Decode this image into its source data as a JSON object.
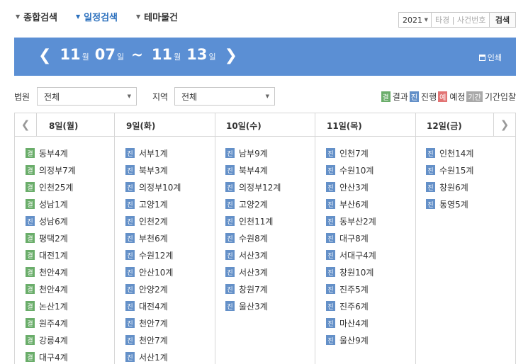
{
  "tabs": [
    {
      "label": "종합검색",
      "active": false
    },
    {
      "label": "일정검색",
      "active": true
    },
    {
      "label": "테마물건",
      "active": false
    }
  ],
  "search": {
    "year": "2021",
    "placeholder": "타경 | 사건번호",
    "button": "검색"
  },
  "banner": {
    "start_month": "11",
    "start_day": "07",
    "end_month": "11",
    "end_day": "13",
    "month_unit": "월",
    "day_unit": "일",
    "tilde": "~",
    "print_label": "인쇄"
  },
  "filters": {
    "court_label": "법원",
    "court_value": "전체",
    "region_label": "지역",
    "region_value": "전체"
  },
  "legend": [
    {
      "badge": "결",
      "label": "결과",
      "color": "#6aad6a"
    },
    {
      "badge": "진",
      "label": "진행",
      "color": "#6490c8"
    },
    {
      "badge": "예",
      "label": "예정",
      "color": "#e27373"
    },
    {
      "badge": "기간",
      "label": "기간입찰",
      "color": "#a9a9a9"
    }
  ],
  "days": [
    {
      "header": "8일(월)",
      "entries": [
        {
          "s": "결",
          "t": "동부4계"
        },
        {
          "s": "결",
          "t": "의정부7계"
        },
        {
          "s": "결",
          "t": "인천25계"
        },
        {
          "s": "결",
          "t": "성남1계"
        },
        {
          "s": "진",
          "t": "성남6계"
        },
        {
          "s": "결",
          "t": "평택2계"
        },
        {
          "s": "결",
          "t": "대전1계"
        },
        {
          "s": "결",
          "t": "천안4계"
        },
        {
          "s": "결",
          "t": "천안4계"
        },
        {
          "s": "결",
          "t": "논산1계"
        },
        {
          "s": "결",
          "t": "원주4계"
        },
        {
          "s": "결",
          "t": "강릉4계"
        },
        {
          "s": "결",
          "t": "대구4계"
        }
      ]
    },
    {
      "header": "9일(화)",
      "entries": [
        {
          "s": "진",
          "t": "서부1계"
        },
        {
          "s": "진",
          "t": "북부3계"
        },
        {
          "s": "진",
          "t": "의정부10계"
        },
        {
          "s": "진",
          "t": "고양1계"
        },
        {
          "s": "진",
          "t": "인천2계"
        },
        {
          "s": "진",
          "t": "부천6계"
        },
        {
          "s": "진",
          "t": "수원12계"
        },
        {
          "s": "진",
          "t": "안산10계"
        },
        {
          "s": "진",
          "t": "안양2계"
        },
        {
          "s": "진",
          "t": "대전4계"
        },
        {
          "s": "진",
          "t": "천안7계"
        },
        {
          "s": "진",
          "t": "천안7계"
        },
        {
          "s": "진",
          "t": "서산1계"
        }
      ]
    },
    {
      "header": "10일(수)",
      "entries": [
        {
          "s": "진",
          "t": "남부9계"
        },
        {
          "s": "진",
          "t": "북부4계"
        },
        {
          "s": "진",
          "t": "의정부12계"
        },
        {
          "s": "진",
          "t": "고양2계"
        },
        {
          "s": "진",
          "t": "인천11계"
        },
        {
          "s": "진",
          "t": "수원8계"
        },
        {
          "s": "진",
          "t": "서산3계"
        },
        {
          "s": "진",
          "t": "서산3계"
        },
        {
          "s": "진",
          "t": "창원7계"
        },
        {
          "s": "진",
          "t": "울산3계"
        }
      ]
    },
    {
      "header": "11일(목)",
      "entries": [
        {
          "s": "진",
          "t": "인천7계"
        },
        {
          "s": "진",
          "t": "수원10계"
        },
        {
          "s": "진",
          "t": "안산3계"
        },
        {
          "s": "진",
          "t": "부산6계"
        },
        {
          "s": "진",
          "t": "동부산2계"
        },
        {
          "s": "진",
          "t": "대구8계"
        },
        {
          "s": "진",
          "t": "서대구4계"
        },
        {
          "s": "진",
          "t": "창원10계"
        },
        {
          "s": "진",
          "t": "진주5계"
        },
        {
          "s": "진",
          "t": "진주6계"
        },
        {
          "s": "진",
          "t": "마산4계"
        },
        {
          "s": "진",
          "t": "울산9계"
        }
      ]
    },
    {
      "header": "12일(금)",
      "entries": [
        {
          "s": "진",
          "t": "인천14계"
        },
        {
          "s": "진",
          "t": "수원15계"
        },
        {
          "s": "진",
          "t": "창원6계"
        },
        {
          "s": "진",
          "t": "통영5계"
        }
      ]
    }
  ]
}
